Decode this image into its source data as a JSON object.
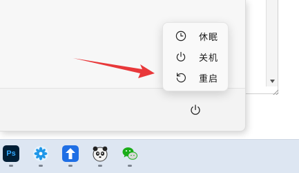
{
  "power_menu": {
    "items": [
      {
        "label": "休眠",
        "icon": "clock-icon"
      },
      {
        "label": "关机",
        "icon": "power-icon"
      },
      {
        "label": "重启",
        "icon": "restart-icon"
      }
    ]
  },
  "taskbar": {
    "apps": [
      {
        "name": "photoshop",
        "text": "Ps",
        "color": "#001e36",
        "accent": "#31a8ff"
      },
      {
        "name": "pinwheel",
        "color": "#e6f3fd",
        "accent": "#1f97e8"
      },
      {
        "name": "blue-arrow",
        "color": "#1f6fe5",
        "accent": "#ffffff"
      },
      {
        "name": "panda",
        "color": "#ffffff",
        "accent": "#222222"
      },
      {
        "name": "wechat",
        "color": "#ffffff",
        "accent": "#1aad19"
      }
    ]
  },
  "colors": {
    "annotation_arrow": "#e8383a",
    "taskbar_bg": "#dde6f2"
  }
}
